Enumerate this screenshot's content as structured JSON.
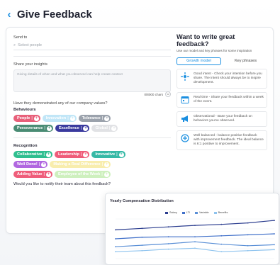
{
  "page": {
    "title": "Give Feedback"
  },
  "form": {
    "send_to_label": "Send to",
    "send_to_placeholder": "Select people",
    "share_label": "Share your insights",
    "share_placeholder": "Giving details of when and what you observed can help create context",
    "char_count": "0/8000 chars",
    "values_question": "Have they demonstrated any of our company values?",
    "behaviours_label": "Behaviours",
    "behaviours": [
      {
        "label": "People",
        "color": "#e8607a",
        "faded": false
      },
      {
        "label": "Innovation",
        "color": "#8fd3f2",
        "faded": true
      },
      {
        "label": "Tolerance",
        "color": "#9ba2ac",
        "faded": false
      },
      {
        "label": "Perseverance",
        "color": "#4a8c74",
        "faded": false
      },
      {
        "label": "Excellence",
        "color": "#3a3a9e",
        "faded": false
      },
      {
        "label": "Global",
        "color": "#c9ccd1",
        "faded": true
      }
    ],
    "recognition_label": "Recognition",
    "recognition": [
      {
        "label": "Collaborative",
        "color": "#2fbf8f",
        "faded": false
      },
      {
        "label": "Leadership",
        "color": "#ef5d7a",
        "faded": false
      },
      {
        "label": "Innovative",
        "color": "#36b9a6",
        "faded": false
      },
      {
        "label": "Well Done!",
        "color": "#b167e0",
        "faded": false
      },
      {
        "label": "Making a Real Difference",
        "color": "#f3e06b",
        "faded": true
      },
      {
        "label": "Adding Value",
        "color": "#ef5d7a",
        "faded": false
      },
      {
        "label": "Employee of the Week",
        "color": "#a7e58a",
        "faded": true
      }
    ],
    "notify_question": "Would you like to notify their team about this feedback?"
  },
  "tips": {
    "title": "Want to write great feedback?",
    "subtitle": "Use our model and key phrases for some inspiration",
    "tabs": [
      "Growth model",
      "Key phrases"
    ],
    "items": [
      {
        "icon": "target-icon",
        "text": "Good intent - Check your intention before you share. The intent should always be to inspire development."
      },
      {
        "icon": "calendar-icon",
        "text": "Real time - Share your feedback within a week of the event."
      },
      {
        "icon": "megaphone-icon",
        "text": "Observational - Base your feedback on behaviors you've observed."
      },
      {
        "icon": "scale-icon",
        "text": "Well balanced - balance positive feedback with improvement feedback. The ideal balance is 6:1 positive to improvement."
      }
    ]
  },
  "chart_data": {
    "type": "line",
    "title": "Yearly Compensation Distribution",
    "xlabel": "",
    "ylabel": "",
    "x": [
      1,
      2,
      3,
      4,
      5,
      6,
      7
    ],
    "series": [
      {
        "name": "Salary",
        "color": "#2c3e8f",
        "values": [
          78,
          81,
          84,
          87,
          89,
          92,
          97
        ]
      },
      {
        "name": "LTI",
        "color": "#3f6fc9",
        "values": [
          60,
          63,
          64,
          64,
          66,
          68,
          70
        ]
      },
      {
        "name": "Variable",
        "color": "#5a8fd6",
        "values": [
          44,
          47,
          50,
          54,
          49,
          46,
          48
        ]
      },
      {
        "name": "Benefits",
        "color": "#8ec3ee",
        "values": [
          34,
          36,
          39,
          41,
          34,
          36,
          38
        ]
      }
    ],
    "ylim": [
      20,
      100
    ],
    "grid": true,
    "legend": "top-center"
  }
}
